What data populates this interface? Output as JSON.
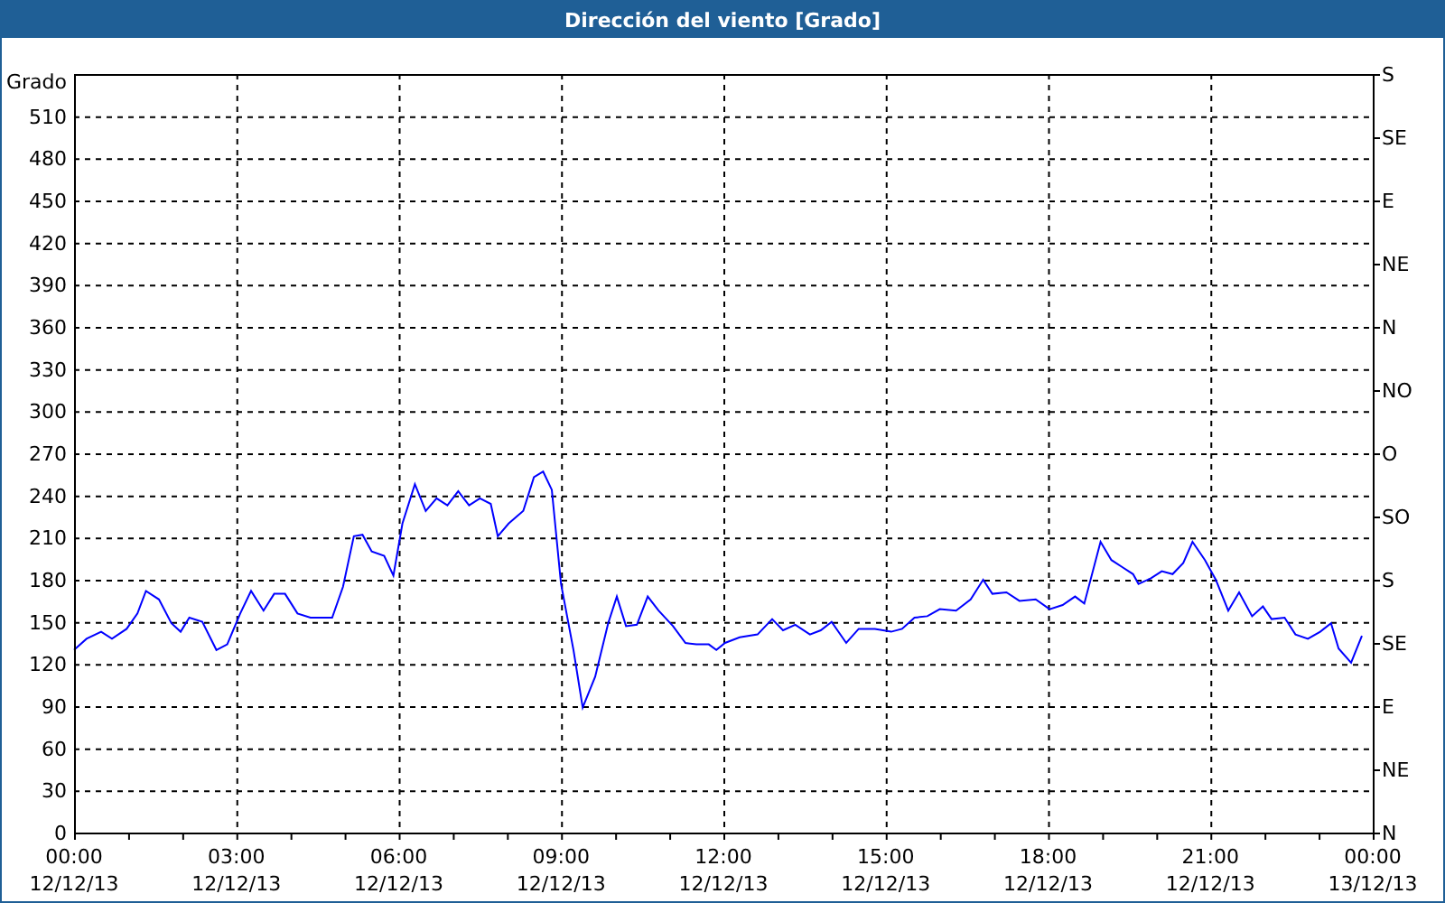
{
  "window": {
    "title": "Dirección del viento [Grado]"
  },
  "chart": {
    "chart_data": {
      "type": "line",
      "ylabel": "Grado",
      "xlim": [
        0,
        24
      ],
      "ylim": [
        0,
        540
      ],
      "x": [
        0,
        0.23,
        0.5,
        0.7,
        0.97,
        1.17,
        1.33,
        1.57,
        1.8,
        1.97,
        2.13,
        2.37,
        2.63,
        2.83,
        3.07,
        3.27,
        3.5,
        3.7,
        3.9,
        4.13,
        4.37,
        4.77,
        4.97,
        5.17,
        5.33,
        5.5,
        5.73,
        5.9,
        6.07,
        6.3,
        6.5,
        6.7,
        6.9,
        7.1,
        7.3,
        7.5,
        7.7,
        7.83,
        8.03,
        8.3,
        8.5,
        8.67,
        8.83,
        9.0,
        9.23,
        9.4,
        9.63,
        9.87,
        10.03,
        10.2,
        10.4,
        10.6,
        10.8,
        11.07,
        11.3,
        11.5,
        11.73,
        11.87,
        12.03,
        12.3,
        12.63,
        12.9,
        13.1,
        13.33,
        13.6,
        13.8,
        14.0,
        14.27,
        14.5,
        14.8,
        15.1,
        15.3,
        15.53,
        15.77,
        16.0,
        16.3,
        16.57,
        16.8,
        16.97,
        17.23,
        17.47,
        17.77,
        18.03,
        18.27,
        18.5,
        18.67,
        18.97,
        19.17,
        19.37,
        19.57,
        19.67,
        19.9,
        20.1,
        20.3,
        20.5,
        20.67,
        20.9,
        21.1,
        21.33,
        21.53,
        21.77,
        21.97,
        22.13,
        22.37,
        22.57,
        22.8,
        23.03,
        23.23,
        23.37,
        23.6,
        23.8
      ],
      "grid": true,
      "series": [
        {
          "color": "#0000ff",
          "values": [
            130,
            138,
            143,
            138,
            145,
            156,
            172,
            166,
            149,
            143,
            153,
            150,
            130,
            134,
            156,
            172,
            158,
            170,
            170,
            156,
            153,
            153,
            175,
            211,
            212,
            200,
            197,
            183,
            220,
            248,
            229,
            238,
            233,
            243,
            233,
            238,
            234,
            211,
            220,
            229,
            253,
            257,
            244,
            177,
            130,
            89,
            111,
            149,
            168,
            147,
            148,
            168,
            158,
            147,
            135,
            134,
            134,
            130,
            135,
            139,
            141,
            152,
            144,
            148,
            141,
            144,
            150,
            135,
            145,
            145,
            143,
            145,
            153,
            154,
            159,
            158,
            166,
            180,
            170,
            171,
            165,
            166,
            159,
            162,
            168,
            163,
            207,
            194,
            189,
            184,
            177,
            181,
            186,
            184,
            192,
            207,
            194,
            180,
            158,
            171,
            154,
            161,
            152,
            153,
            141,
            138,
            143,
            149,
            131,
            121,
            140
          ]
        }
      ],
      "yticks": [
        0,
        30,
        60,
        90,
        120,
        150,
        180,
        210,
        240,
        270,
        300,
        330,
        360,
        390,
        420,
        450,
        480,
        510
      ],
      "xticks": [
        {
          "value": 0,
          "label": "00:00"
        },
        {
          "value": 3,
          "label": "03:00"
        },
        {
          "value": 6,
          "label": "06:00"
        },
        {
          "value": 9,
          "label": "09:00"
        },
        {
          "value": 12,
          "label": "12:00"
        },
        {
          "value": 15,
          "label": "15:00"
        },
        {
          "value": 18,
          "label": "18:00"
        },
        {
          "value": 21,
          "label": "21:00"
        },
        {
          "value": 24,
          "label": "00:00"
        }
      ]
    },
    "xtick_dates": [
      "12/12/13",
      "12/12/13",
      "12/12/13",
      "12/12/13",
      "12/12/13",
      "12/12/13",
      "12/12/13",
      "12/12/13",
      "13/12/13"
    ],
    "right_axis_labels": [
      "S",
      "SE",
      "E",
      "NE",
      "N",
      "NO",
      "O",
      "SO",
      "S",
      "SE",
      "E",
      "NE",
      "N"
    ]
  }
}
